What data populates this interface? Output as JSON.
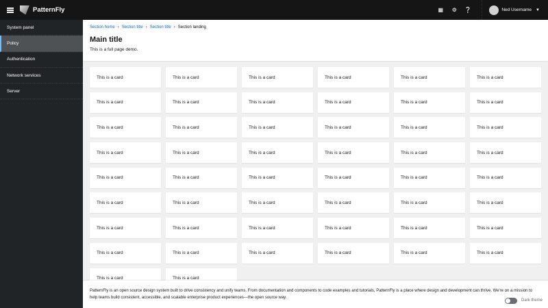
{
  "header": {
    "brand": "PatternFly",
    "user": "Ned Username",
    "icons": [
      "apps-grid-icon",
      "gear-icon",
      "help-icon"
    ]
  },
  "sidebar": {
    "items": [
      {
        "label": "System panel"
      },
      {
        "label": "Policy",
        "active": true
      },
      {
        "label": "Authentication"
      },
      {
        "label": "Network services"
      },
      {
        "label": "Server"
      }
    ]
  },
  "breadcrumb": [
    "Section home",
    "Section title",
    "Section title",
    "Section landing"
  ],
  "page": {
    "title": "Main title",
    "description": "This is a full page demo."
  },
  "cards": {
    "label": "This is a card",
    "count": 50
  },
  "footer": {
    "text": "PatternFly is an open source design system built to drive consistency and unify teams. From documentation and components to code examples and tutorials, PatternFly is a place where design and development can thrive. We're on a mission to help teams build consistent, accessible, and scalable enterprise product experiences—the open source way.",
    "toggle_label": "Dark theme",
    "toggle_on": false
  },
  "colors": {
    "masthead": "#151515",
    "sidebar": "#212427",
    "link": "#0066cc",
    "active_accent": "#73bcf7"
  }
}
